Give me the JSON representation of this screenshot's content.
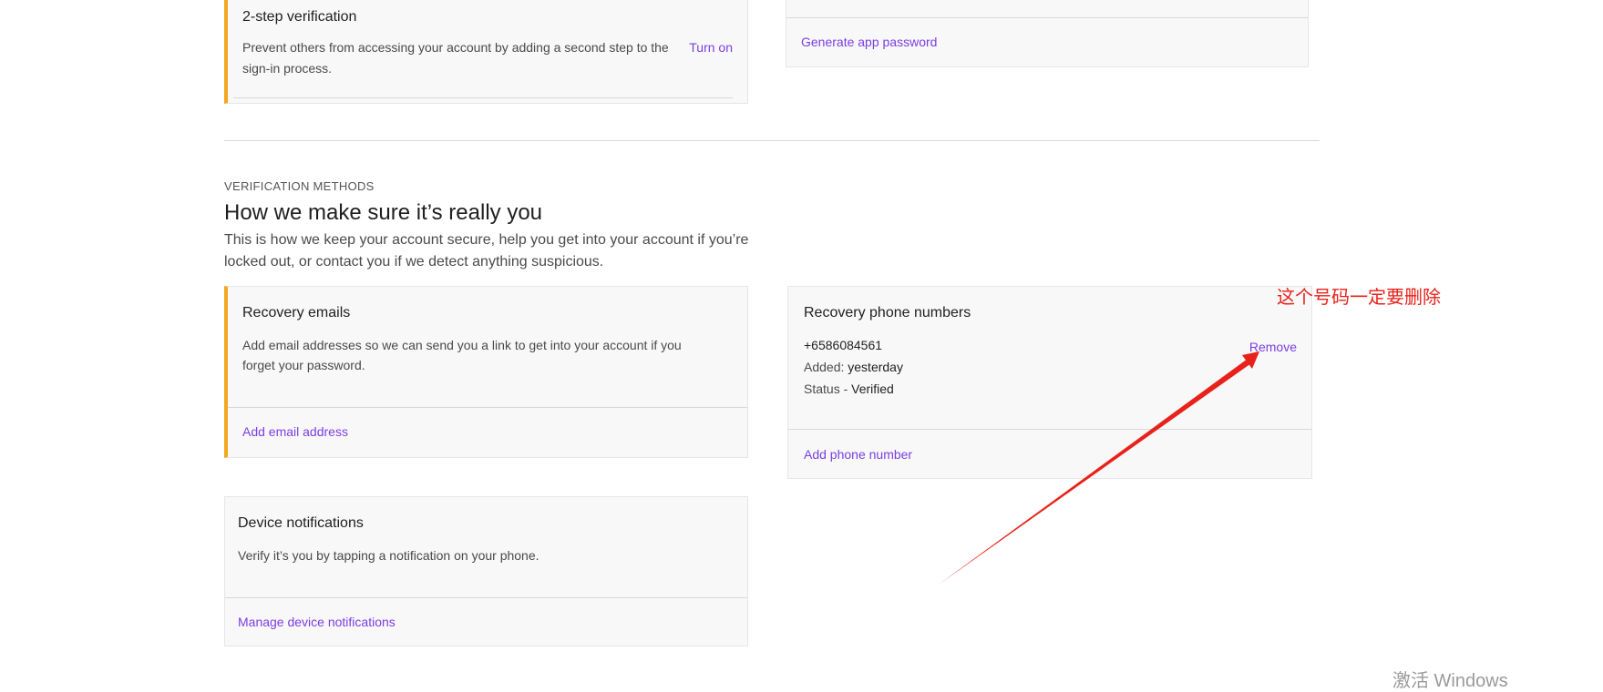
{
  "two_step": {
    "title": "2-step verification",
    "description": "Prevent others from accessing your account by adding a second step to the sign-in process.",
    "action": "Turn on"
  },
  "app_password": {
    "action": "Generate app password"
  },
  "verification": {
    "eyebrow": "VERIFICATION METHODS",
    "heading": "How we make sure it’s really you",
    "subheading": "This is how we keep your account secure, help you get into your account if you’re locked out, or contact you if we detect anything suspicious."
  },
  "recovery_emails": {
    "title": "Recovery emails",
    "description": "Add email addresses so we can send you a link to get into your account if you forget your password.",
    "action": "Add email address"
  },
  "recovery_phones": {
    "title": "Recovery phone numbers",
    "number": "+6586084561",
    "added_label": "Added:",
    "added_value": "yesterday",
    "status_label": "Status -",
    "status_value": "Verified",
    "remove": "Remove",
    "action": "Add phone number"
  },
  "device_notifications": {
    "title": "Device notifications",
    "description": "Verify it’s you by tapping a notification on your phone.",
    "action": "Manage device notifications"
  },
  "annotation": {
    "text": "这个号码一定要删除",
    "color": "#e8221b"
  },
  "watermark": {
    "text": "激活 Windows"
  },
  "colors": {
    "accent": "#f2a81d",
    "link": "#7b3fe4",
    "card_bg": "#f8f8f8"
  }
}
